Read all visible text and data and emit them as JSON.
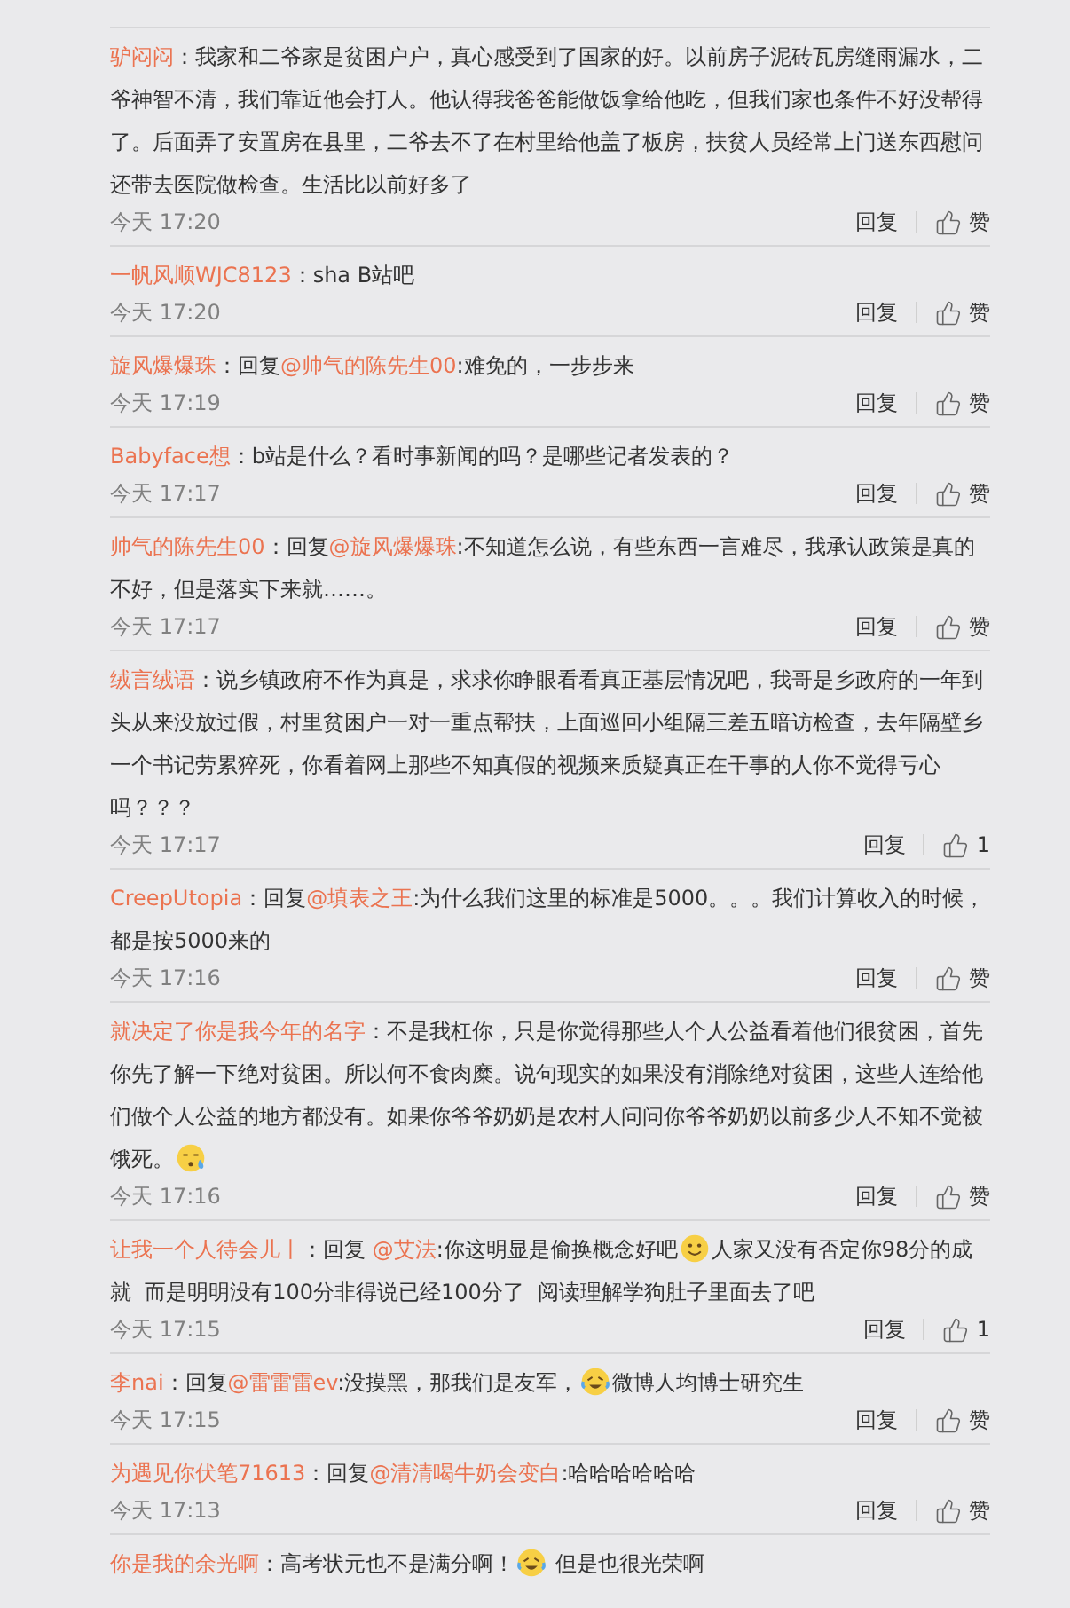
{
  "comments": [
    {
      "author": "驴闷闷",
      "parts": [
        {
          "kind": "text",
          "text": "：我家和二爷家是贫困户户，真心感受到了国家的好。以前房子泥砖瓦房缝雨漏水，二爷神智不清，我们靠近他会打人。他认得我爸爸能做饭拿给他吃，但我们家也条件不好没帮得了。后面弄了安置房在县里，二爷去不了在村里给他盖了板房，扶贫人员经常上门送东西慰问还带去医院做检查。生活比以前好多了"
        }
      ],
      "time": "今天 17:20",
      "reply": "回复",
      "like": "赞"
    },
    {
      "author": "一帆风顺WJC8123",
      "parts": [
        {
          "kind": "text",
          "text": "：sha B站吧"
        }
      ],
      "time": "今天 17:20",
      "reply": "回复",
      "like": "赞"
    },
    {
      "author": "旋风爆爆珠",
      "parts": [
        {
          "kind": "text",
          "text": "：回复"
        },
        {
          "kind": "mention",
          "text": "@帅气的陈先生00"
        },
        {
          "kind": "text",
          "text": ":难免的，一步步来"
        }
      ],
      "time": "今天 17:19",
      "reply": "回复",
      "like": "赞"
    },
    {
      "author": "Babyface想",
      "parts": [
        {
          "kind": "text",
          "text": "：b站是什么？看时事新闻的吗？是哪些记者发表的？"
        }
      ],
      "time": "今天 17:17",
      "reply": "回复",
      "like": "赞"
    },
    {
      "author": "帅气的陈先生00",
      "parts": [
        {
          "kind": "text",
          "text": "：回复"
        },
        {
          "kind": "mention",
          "text": "@旋风爆爆珠"
        },
        {
          "kind": "text",
          "text": ":不知道怎么说，有些东西一言难尽，我承认政策是真的不好，但是落实下来就……。"
        }
      ],
      "time": "今天 17:17",
      "reply": "回复",
      "like": "赞"
    },
    {
      "author": "绒言绒语",
      "parts": [
        {
          "kind": "text",
          "text": "：说乡镇政府不作为真是，求求你睁眼看看真正基层情况吧，我哥是乡政府的一年到头从来没放过假，村里贫困户一对一重点帮扶，上面巡回小组隔三差五暗访检查，去年隔壁乡一个书记劳累猝死，你看着网上那些不知真假的视频来质疑真正在干事的人你不觉得亏心吗？？？"
        }
      ],
      "time": "今天 17:17",
      "reply": "回复",
      "like": "1"
    },
    {
      "author": "CreepUtopia",
      "parts": [
        {
          "kind": "text",
          "text": "：回复"
        },
        {
          "kind": "mention",
          "text": "@填表之王"
        },
        {
          "kind": "text",
          "text": ":为什么我们这里的标准是5000。。。我们计算收入的时候，都是按5000来的"
        }
      ],
      "time": "今天 17:16",
      "reply": "回复",
      "like": "赞"
    },
    {
      "author": "就决定了你是我今年的名字",
      "parts": [
        {
          "kind": "text",
          "text": "：不是我杠你，只是你觉得那些人个人公益看着他们很贫困，首先你先了解一下绝对贫困。所以何不食肉糜。说句现实的如果没有消除绝对贫困，这些人连给他们做个人公益的地方都没有。如果你爷爷奶奶是农村人问问你爷爷奶奶以前多少人不知不觉被饿死。"
        },
        {
          "kind": "sweat"
        }
      ],
      "time": "今天 17:16",
      "reply": "回复",
      "like": "赞"
    },
    {
      "author": "让我一个人待会儿丨",
      "parts": [
        {
          "kind": "text",
          "text": "：回复 "
        },
        {
          "kind": "mention",
          "text": "@艾法"
        },
        {
          "kind": "text",
          "text": ":你这明显是偷换概念好吧"
        },
        {
          "kind": "smile"
        },
        {
          "kind": "text",
          "text": "人家又没有否定你98分的成就  而是明明没有100分非得说已经100分了  阅读理解学狗肚子里面去了吧"
        }
      ],
      "time": "今天 17:15",
      "reply": "回复",
      "like": "1"
    },
    {
      "author": "李nai",
      "parts": [
        {
          "kind": "text",
          "text": "：回复"
        },
        {
          "kind": "mention",
          "text": "@雷雷雷ev"
        },
        {
          "kind": "text",
          "text": ":没摸黑，那我们是友军，"
        },
        {
          "kind": "laugh"
        },
        {
          "kind": "text",
          "text": "微博人均博士研究生"
        }
      ],
      "time": "今天 17:15",
      "reply": "回复",
      "like": "赞"
    },
    {
      "author": "为遇见你伏笔71613",
      "parts": [
        {
          "kind": "text",
          "text": "：回复"
        },
        {
          "kind": "mention",
          "text": "@清清喝牛奶会变白"
        },
        {
          "kind": "text",
          "text": ":哈哈哈哈哈哈"
        }
      ],
      "time": "今天 17:13",
      "reply": "回复",
      "like": "赞"
    },
    {
      "author": "你是我的余光啊",
      "parts": [
        {
          "kind": "text",
          "text": "：高考状元也不是满分啊！"
        },
        {
          "kind": "laugh"
        },
        {
          "kind": "text",
          "text": " 但是也很光荣啊"
        }
      ]
    }
  ]
}
